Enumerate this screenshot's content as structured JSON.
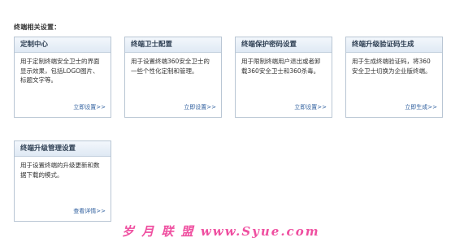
{
  "section": {
    "title": "终端相关设置："
  },
  "cards": [
    {
      "title": "定制中心",
      "desc": "用于定制终端安全卫士的界面显示效果，包括LOGO图片、标题文字等。",
      "link": "立即设置>>"
    },
    {
      "title": "终端卫士配置",
      "desc": "用于设置终端360安全卫士的一些个性化定制和管理。",
      "link": "立即设置>>"
    },
    {
      "title": "终端保护密码设置",
      "desc": "用于限制终端用户退出或者卸载360安全卫士和360杀毒。",
      "link": "立即设置>>"
    },
    {
      "title": "终端升级验证码生成",
      "desc": "用于生成终端验证码，将360安全卫士切换为企业版终端。",
      "link": "立即生成>>"
    },
    {
      "title": "终端升级管理设置",
      "desc": "用于设置终端的升级更新和数据下载的模式。",
      "link": "查看详情>>"
    }
  ],
  "watermark": {
    "text": "岁 月 联 盟 www.Syue.com"
  },
  "colors": {
    "card_border": "#b9c6d4",
    "header_bg": "#dfe9f4",
    "link": "#2f5f9e",
    "watermark": "#ef4fa0"
  }
}
